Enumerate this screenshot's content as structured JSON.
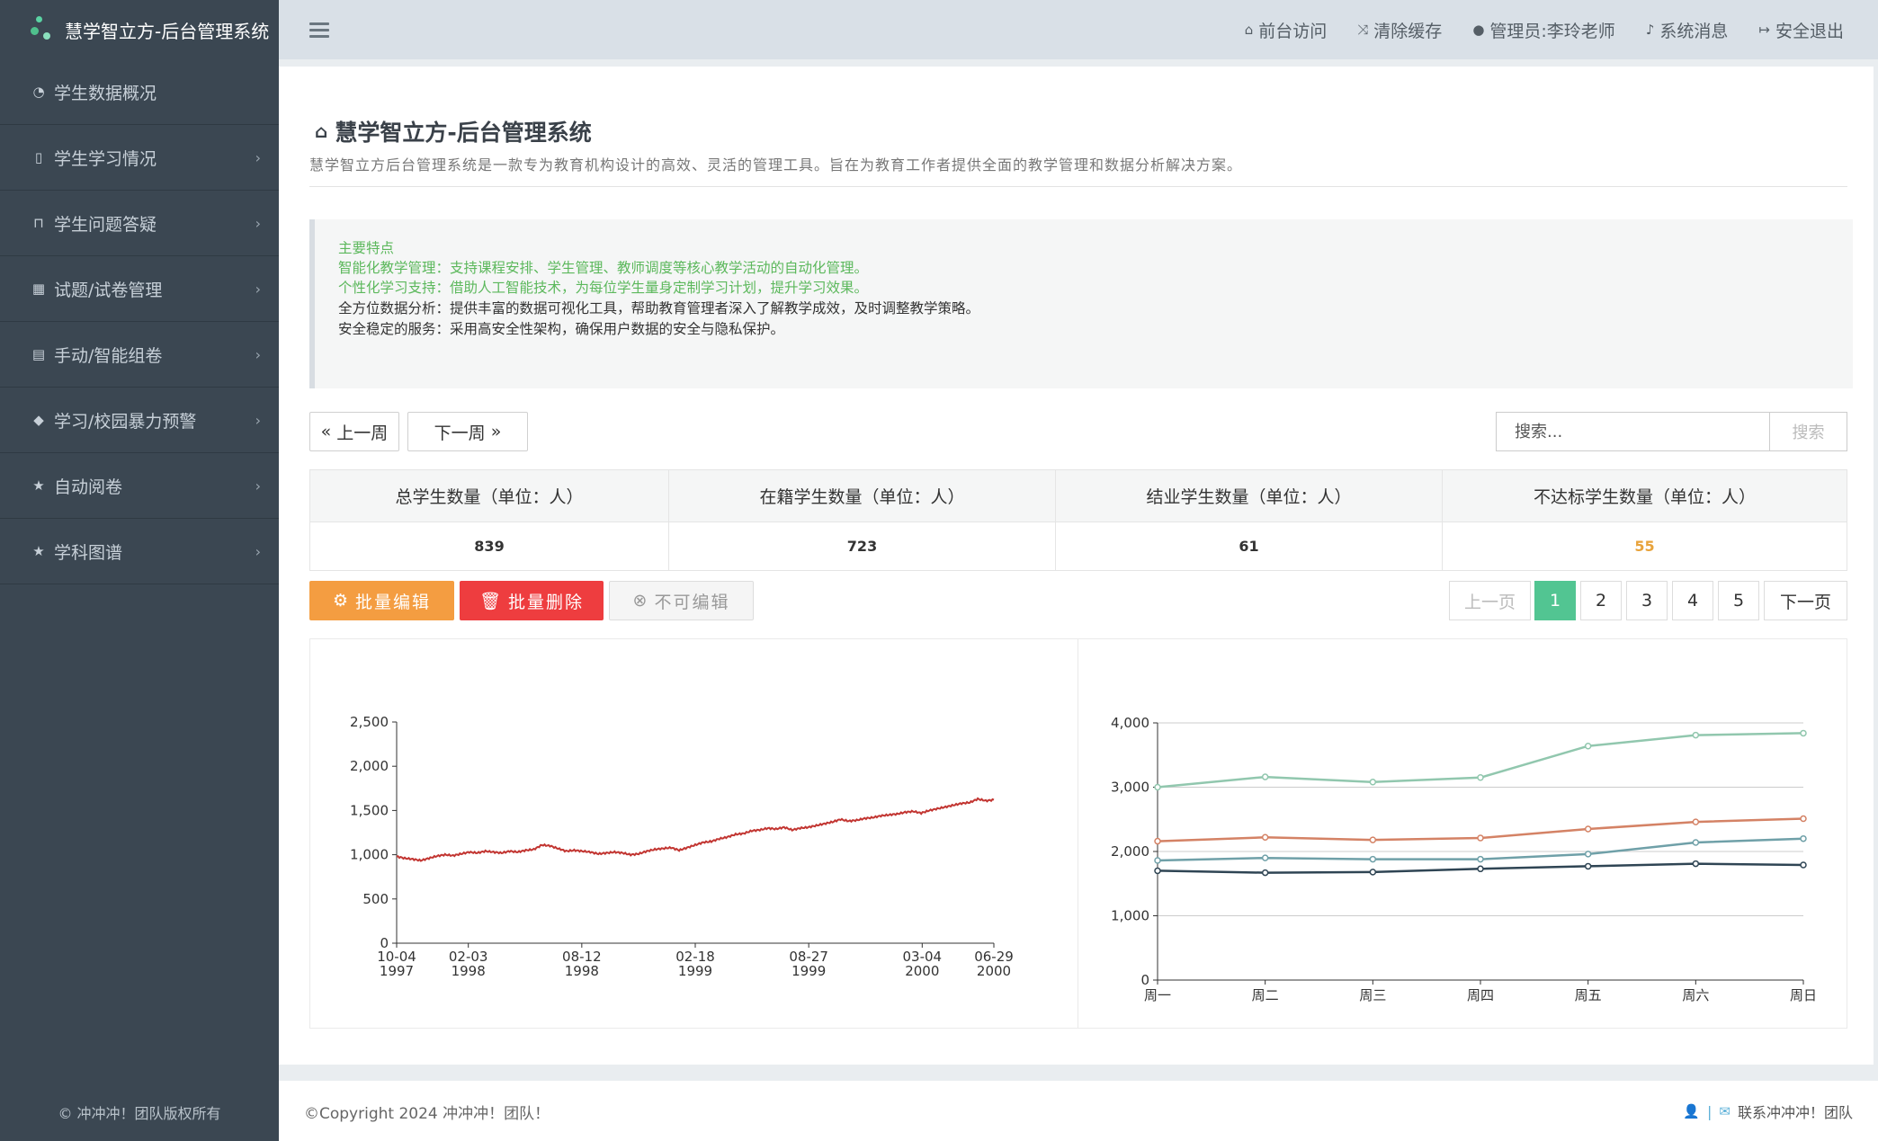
{
  "app": {
    "title": "慧学智立方-后台管理系统",
    "sidebar_footer": "© 冲冲冲！团队版权所有"
  },
  "sidebar": {
    "items": [
      {
        "label": "学生数据概况",
        "icon": "dashboard-icon",
        "has_submenu": false
      },
      {
        "label": "学生学习情况",
        "icon": "columns-icon",
        "has_submenu": true
      },
      {
        "label": "学生问题答疑",
        "icon": "inbox-icon",
        "has_submenu": true
      },
      {
        "label": "试题/试卷管理",
        "icon": "table-icon",
        "has_submenu": true
      },
      {
        "label": "手动/智能组卷",
        "icon": "list-alt-icon",
        "has_submenu": true
      },
      {
        "label": "学习/校园暴力预警",
        "icon": "tags-icon",
        "has_submenu": true
      },
      {
        "label": "自动阅卷",
        "icon": "star-icon",
        "has_submenu": true
      },
      {
        "label": "学科图谱",
        "icon": "star-icon",
        "has_submenu": true
      }
    ]
  },
  "topbar": {
    "links": [
      {
        "label": "前台访问",
        "icon": "home-icon"
      },
      {
        "label": "清除缓存",
        "icon": "random-icon"
      },
      {
        "label": "管理员:李玲老师",
        "icon": "user-icon"
      },
      {
        "label": "系统消息",
        "icon": "bell-icon"
      },
      {
        "label": "安全退出",
        "icon": "sign-out-icon"
      }
    ]
  },
  "page": {
    "title": "慧学智立方-后台管理系统",
    "description": "慧学智立方后台管理系统是一款专为教育机构设计的高效、灵活的管理工具。旨在为教育工作者提供全面的教学管理和数据分析解决方案。"
  },
  "callout": {
    "heading": "主要特点",
    "lines": [
      "智能化教学管理：支持课程安排、学生管理、教师调度等核心教学活动的自动化管理。",
      "个性化学习支持：借助人工智能技术，为每位学生量身定制学习计划，提升学习效果。",
      "全方位数据分析：提供丰富的数据可视化工具，帮助教育管理者深入了解教学成效，及时调整教学策略。",
      "安全稳定的服务：采用高安全性架构，确保用户数据的安全与隐私保护。"
    ]
  },
  "week_nav": {
    "prev_label": "上一周",
    "next_label": "下一周"
  },
  "search": {
    "placeholder": "搜索...",
    "button_label": "搜索"
  },
  "stats": {
    "headers": [
      "总学生数量（单位：人）",
      "在籍学生数量（单位：人）",
      "结业学生数量（单位：人）",
      "不达标学生数量（单位：人）"
    ],
    "values": [
      "839",
      "723",
      "61",
      "55"
    ],
    "highlight_color": "#e8a33b"
  },
  "actions": {
    "batch_edit_label": "批量编辑",
    "batch_delete_label": "批量删除",
    "not_editable_label": "不可编辑",
    "batch_edit_color": "#f49d41",
    "batch_delete_color": "#ee3d3f"
  },
  "pagination": {
    "prev_label": "上一页",
    "next_label": "下一页",
    "pages": [
      "1",
      "2",
      "3",
      "4",
      "5"
    ],
    "active_page": "1",
    "active_color": "#52c592"
  },
  "footer": {
    "copyright": "©Copyright 2024 冲冲冲！团队！",
    "contact_label": "联系冲冲冲！团队",
    "separator": "|"
  },
  "chart_data": [
    {
      "type": "line",
      "x_tick_labels": [
        [
          "10-04",
          "1997"
        ],
        [
          "02-03",
          "1998"
        ],
        [
          "08-12",
          "1998"
        ],
        [
          "02-18",
          "1999"
        ],
        [
          "08-27",
          "1999"
        ],
        [
          "03-04",
          "2000"
        ],
        [
          "06-29",
          "2000"
        ]
      ],
      "x_tick_positions": [
        0,
        0.12,
        0.31,
        0.5,
        0.69,
        0.88,
        1.0
      ],
      "ylim": [
        0,
        2500
      ],
      "y_ticks": [
        0,
        500,
        1000,
        1500,
        2000,
        2500
      ],
      "color": "#c23531",
      "series": [
        {
          "values": [
            980,
            960,
            950,
            935,
            960,
            985,
            1000,
            990,
            1010,
            1030,
            1020,
            1040,
            1030,
            1020,
            1040,
            1030,
            1050,
            1060,
            1110,
            1100,
            1070,
            1040,
            1050,
            1040,
            1030,
            1010,
            1020,
            1030,
            1020,
            1000,
            1010,
            1040,
            1060,
            1070,
            1080,
            1050,
            1080,
            1110,
            1140,
            1150,
            1180,
            1200,
            1230,
            1240,
            1270,
            1280,
            1300,
            1290,
            1310,
            1280,
            1300,
            1310,
            1330,
            1350,
            1370,
            1400,
            1380,
            1390,
            1410,
            1420,
            1440,
            1450,
            1460,
            1480,
            1490,
            1470,
            1500,
            1520,
            1540,
            1560,
            1580,
            1590,
            1630,
            1610,
            1620
          ]
        }
      ]
    },
    {
      "type": "line",
      "categories": [
        "周一",
        "周二",
        "周三",
        "周四",
        "周五",
        "周六",
        "周日"
      ],
      "ylim": [
        0,
        4000
      ],
      "y_ticks": [
        0,
        1000,
        2000,
        3000,
        4000
      ],
      "series": [
        {
          "color": "#91c7ae",
          "values": [
            3000,
            3160,
            3080,
            3150,
            3640,
            3810,
            3840
          ]
        },
        {
          "color": "#d48265",
          "values": [
            2160,
            2220,
            2180,
            2210,
            2350,
            2460,
            2510
          ]
        },
        {
          "color": "#6fa0a8",
          "values": [
            1860,
            1900,
            1880,
            1880,
            1960,
            2140,
            2200
          ]
        },
        {
          "color": "#2f4554",
          "values": [
            1700,
            1670,
            1680,
            1730,
            1770,
            1810,
            1790
          ]
        }
      ]
    }
  ]
}
